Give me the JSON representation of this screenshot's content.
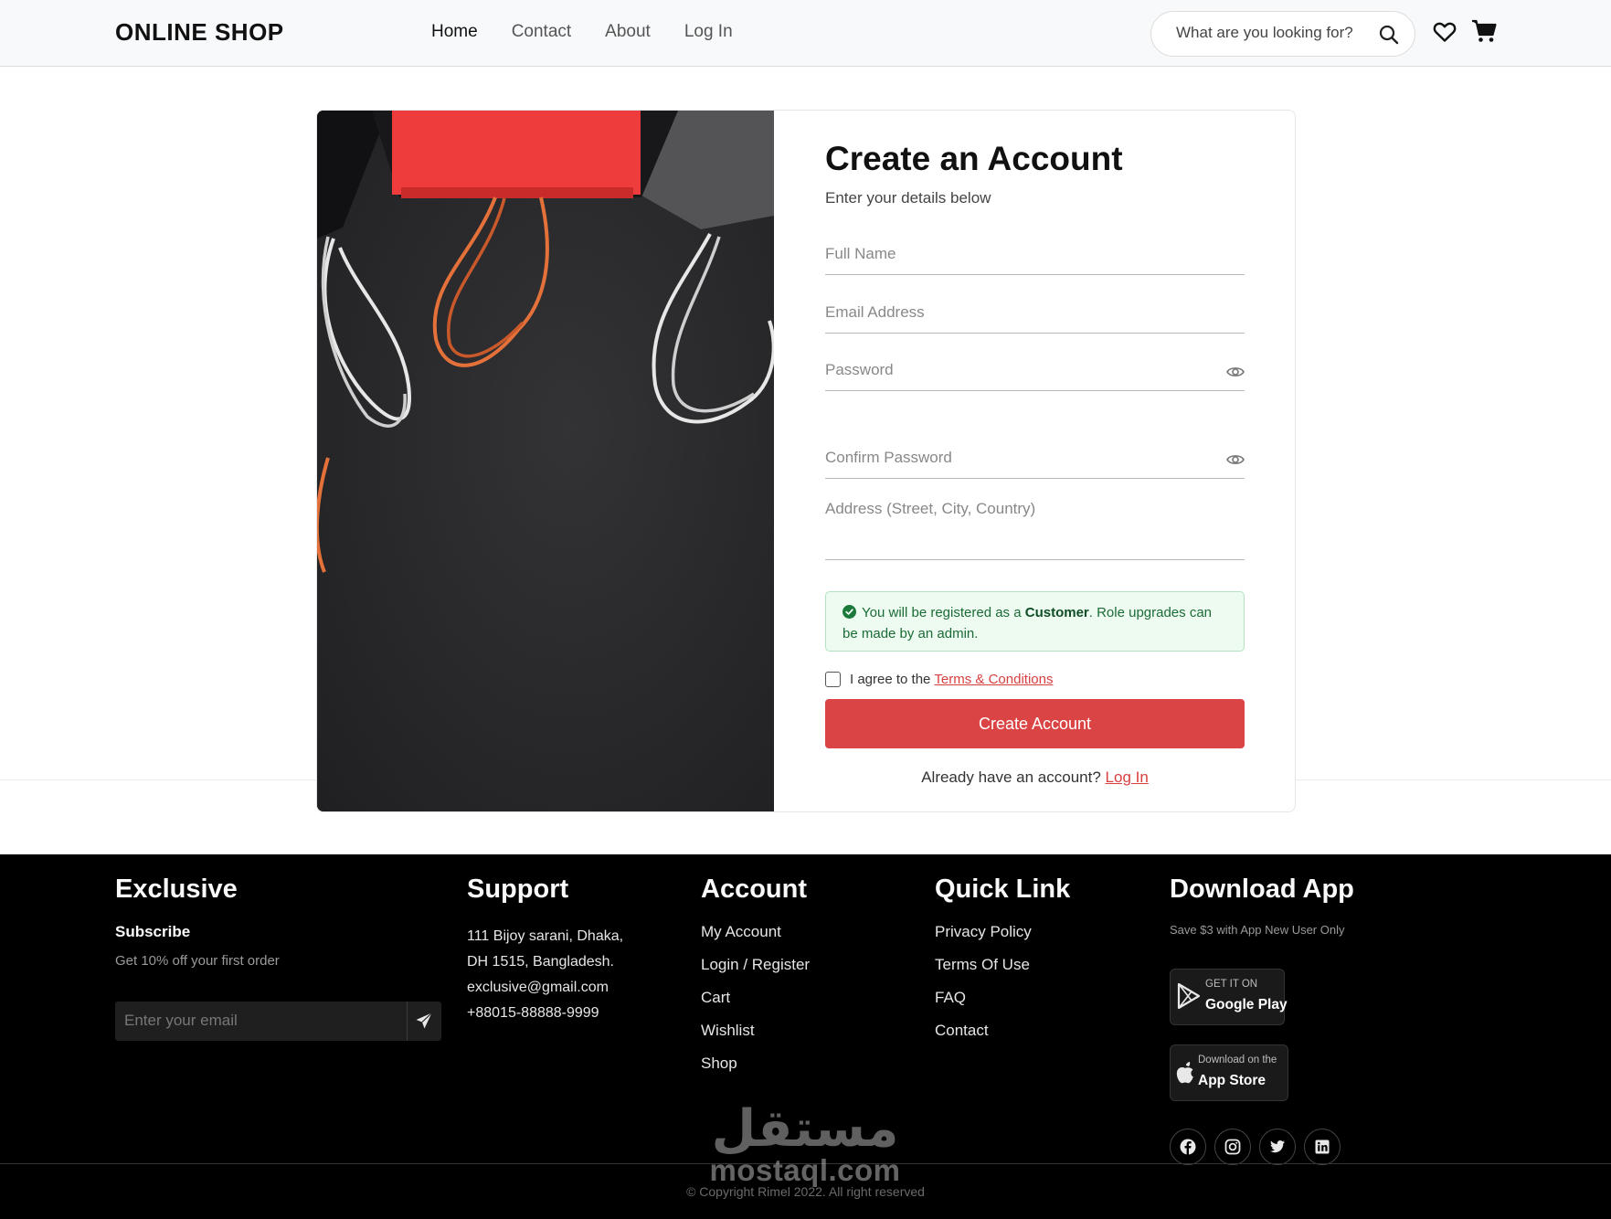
{
  "header": {
    "logo": "ONLINE SHOP",
    "nav": [
      {
        "label": "Home",
        "active": true
      },
      {
        "label": "Contact",
        "active": false
      },
      {
        "label": "About",
        "active": false
      },
      {
        "label": "Log In",
        "active": false
      }
    ],
    "search_placeholder": "What are you looking for?",
    "icons": [
      "search-icon",
      "heart-icon",
      "cart-icon"
    ]
  },
  "form": {
    "title": "Create an Account",
    "subtitle": "Enter your details below",
    "fields": {
      "full_name": {
        "placeholder": "Full Name",
        "value": ""
      },
      "email": {
        "placeholder": "Email Address",
        "value": ""
      },
      "password": {
        "placeholder": "Password",
        "value": ""
      },
      "confirm_password": {
        "placeholder": "Confirm Password",
        "value": ""
      },
      "address": {
        "placeholder": "Address (Street, City, Country)",
        "value": ""
      }
    },
    "notice": {
      "prefix": "You will be registered as a",
      "role": "Customer",
      "suffix": ". Role upgrades can be made by an admin."
    },
    "terms": {
      "text": "I agree to the",
      "link": "Terms & Conditions",
      "checked": false
    },
    "submit_label": "Create Account",
    "login_prompt": "Already have an account?",
    "login_link": "Log In"
  },
  "footer": {
    "exclusive": {
      "title": "Exclusive",
      "subscribe_title": "Subscribe",
      "subscribe_text": "Get 10% off your first order",
      "email_placeholder": "Enter your email"
    },
    "support": {
      "title": "Support",
      "address_line1": "111 Bijoy sarani, Dhaka,",
      "address_line2": "DH 1515, Bangladesh.",
      "email": "exclusive@gmail.com",
      "phone": "+88015-88888-9999"
    },
    "account": {
      "title": "Account",
      "links": [
        "My Account",
        "Login / Register",
        "Cart",
        "Wishlist",
        "Shop"
      ]
    },
    "quick_link": {
      "title": "Quick Link",
      "links": [
        "Privacy Policy",
        "Terms Of Use",
        "FAQ",
        "Contact"
      ]
    },
    "download": {
      "title": "Download App",
      "save_text": "Save $3 with App New User Only",
      "google_small": "GET IT ON",
      "google_big": "Google Play",
      "apple_small": "Download on the",
      "apple_big": "App Store"
    },
    "social_icons": [
      "facebook-icon",
      "instagram-icon",
      "twitter-icon",
      "linkedin-icon"
    ],
    "copyright": "© Copyright Rimel 2022. All right reserved"
  },
  "watermark": {
    "arabic": "مستقل",
    "latin": "mostaql.com"
  },
  "colors": {
    "accent": "#db4444",
    "notice_bg": "#eefbf1",
    "notice_text": "#1b6b36",
    "footer_bg": "#000000"
  }
}
